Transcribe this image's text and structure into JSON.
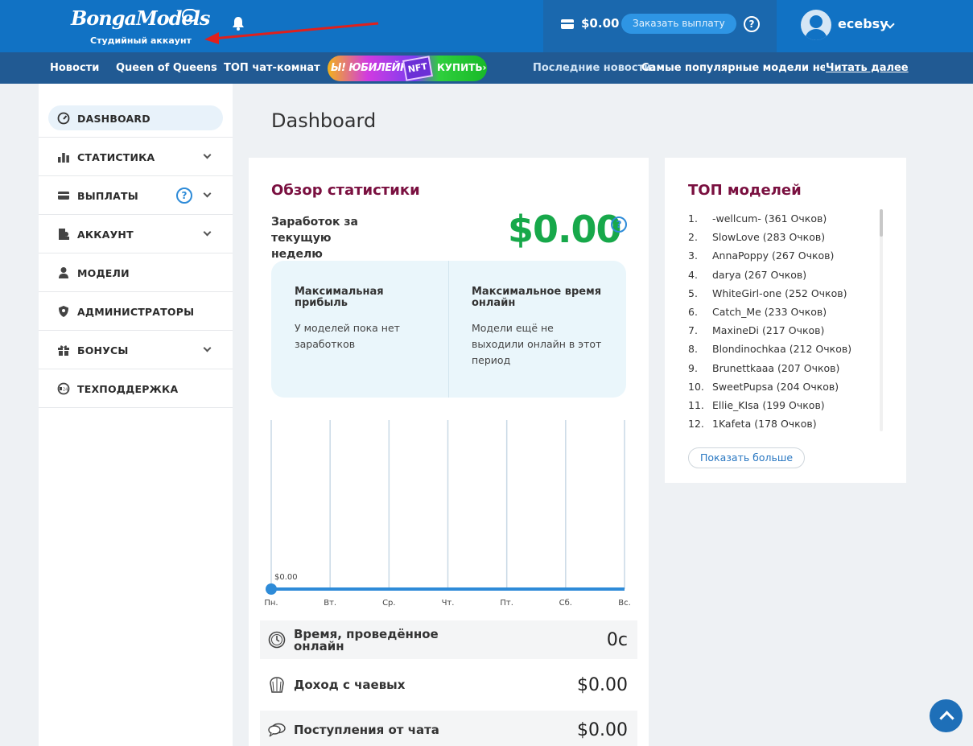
{
  "header": {
    "logo_text": "BongaModels",
    "logo_subtitle": "Студийный аккаунт",
    "balance": "$0.00",
    "payout_button": "Заказать выплату",
    "help_glyph": "?",
    "username": "ecebsy",
    "colors": {
      "primary": "#1172c4",
      "nav": "#215a93"
    }
  },
  "nav": {
    "items": [
      "Новости",
      "Queen of Queens",
      "ТОП чат-комнат"
    ],
    "promo": {
      "text": "Ы! ЮБИЛЕЙНАЯ",
      "badge": "NFT",
      "buy": "КУПИТЬ›"
    },
    "news_label": "Последние новости:",
    "news_text": "Самые популярные модели недели",
    "news_more": "Читать далее"
  },
  "sidebar": {
    "items": [
      {
        "label": "DASHBOARD",
        "icon": "gauge-icon"
      },
      {
        "label": "СТАТИСТИКА",
        "icon": "bar-chart-icon"
      },
      {
        "label": "ВЫПЛАТЫ",
        "icon": "card-icon"
      },
      {
        "label": "АККАУНТ",
        "icon": "account-icon"
      },
      {
        "label": "МОДЕЛИ",
        "icon": "user-icon"
      },
      {
        "label": "АДМИНИСТРАТОРЫ",
        "icon": "shield-icon"
      },
      {
        "label": "БОНУСЫ",
        "icon": "gift-icon"
      },
      {
        "label": "ТЕХПОДДЕРЖКА",
        "icon": "support-24-icon"
      }
    ]
  },
  "main": {
    "page_title": "Dashboard",
    "stats": {
      "title": "Обзор статистики",
      "earnings_label": "Заработок за текущую неделю",
      "earnings_value": "$0.00",
      "max_profit_title": "Максимальная прибыль",
      "max_profit_text": "У моделей пока нет заработков",
      "max_online_title": "Максимальное время онлайн",
      "max_online_text": "Модели ещё не выходили онлайн в этот период"
    },
    "metrics": [
      {
        "label": "Время, проведённое онлайн",
        "value": "0с",
        "icon": "clock-icon"
      },
      {
        "label": "Доход с чаевых",
        "value": "$0.00",
        "icon": "tip-jar-icon"
      },
      {
        "label": "Поступления от чата",
        "value": "$0.00",
        "icon": "chat-icon"
      }
    ]
  },
  "chart_data": {
    "type": "line",
    "categories": [
      "Пн.",
      "Вт.",
      "Ср.",
      "Чт.",
      "Пт.",
      "Сб.",
      "Вс."
    ],
    "series": [
      {
        "values": [
          0,
          0,
          0,
          0,
          0,
          0,
          0
        ]
      }
    ],
    "data_label": "$0.00",
    "color": "#2e8bd8"
  },
  "top_models": {
    "title": "ТОП моделей",
    "items": [
      {
        "rank": "1.",
        "name": "-wellcum-",
        "points": "(361 Очков)"
      },
      {
        "rank": "2.",
        "name": "SlowLove",
        "points": "(283 Очков)"
      },
      {
        "rank": "3.",
        "name": "AnnaPoppy",
        "points": "(267 Очков)"
      },
      {
        "rank": "4.",
        "name": "darya",
        "points": "(267 Очков)"
      },
      {
        "rank": "5.",
        "name": "WhiteGirl-one",
        "points": "(252 Очков)"
      },
      {
        "rank": "6.",
        "name": "Catch_Me",
        "points": "(233 Очков)"
      },
      {
        "rank": "7.",
        "name": "MaxineDi",
        "points": "(217 Очков)"
      },
      {
        "rank": "8.",
        "name": "Blondinochkaa",
        "points": "(212 Очков)"
      },
      {
        "rank": "9.",
        "name": "Brunettkaaa",
        "points": "(207 Очков)"
      },
      {
        "rank": "10.",
        "name": "SweetPupsa",
        "points": "(204 Очков)"
      },
      {
        "rank": "11.",
        "name": "Ellie_KIsa",
        "points": "(199 Очков)"
      },
      {
        "rank": "12.",
        "name": "1Kafeta",
        "points": "(178 Очков)"
      }
    ],
    "show_more": "Показать больше"
  }
}
